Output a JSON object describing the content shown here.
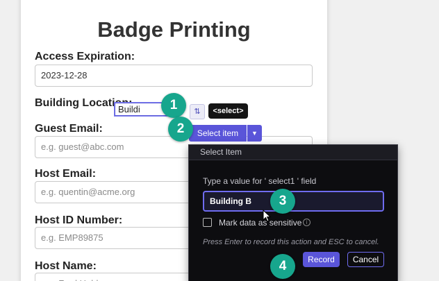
{
  "form": {
    "title": "Badge Printing",
    "access_expiration": {
      "label": "Access Expiration:",
      "value": "2023-12-28"
    },
    "building_location": {
      "label": "Building Location:",
      "value": "Buildi"
    },
    "guest_email": {
      "label": "Guest Email:",
      "placeholder": "e.g. guest@abc.com"
    },
    "host_email": {
      "label": "Host Email:",
      "placeholder": "e.g. quentin@acme.org"
    },
    "host_id": {
      "label": "Host ID Number:",
      "placeholder": "e.g. EMP89875"
    },
    "host_name": {
      "label": "Host Name:",
      "placeholder": "e.g. Fred Hubbs"
    }
  },
  "recorder": {
    "element_tag": "<select>",
    "select_item_label": "Select item",
    "caret_icon": "chevron-down-icon",
    "dialog": {
      "title": "Select Item",
      "prompt": "Type a value for ' select1 ' field",
      "input_value": "Building B",
      "sensitive_label": "Mark data as sensitive",
      "hint": "Press Enter to record this action and ESC to cancel.",
      "record_label": "Record",
      "cancel_label": "Cancel"
    }
  },
  "markers": [
    "1",
    "2",
    "3",
    "4"
  ],
  "colors": {
    "accent": "#5a55d9",
    "marker": "#17a68d",
    "dialog_bg": "#0d0d10"
  }
}
